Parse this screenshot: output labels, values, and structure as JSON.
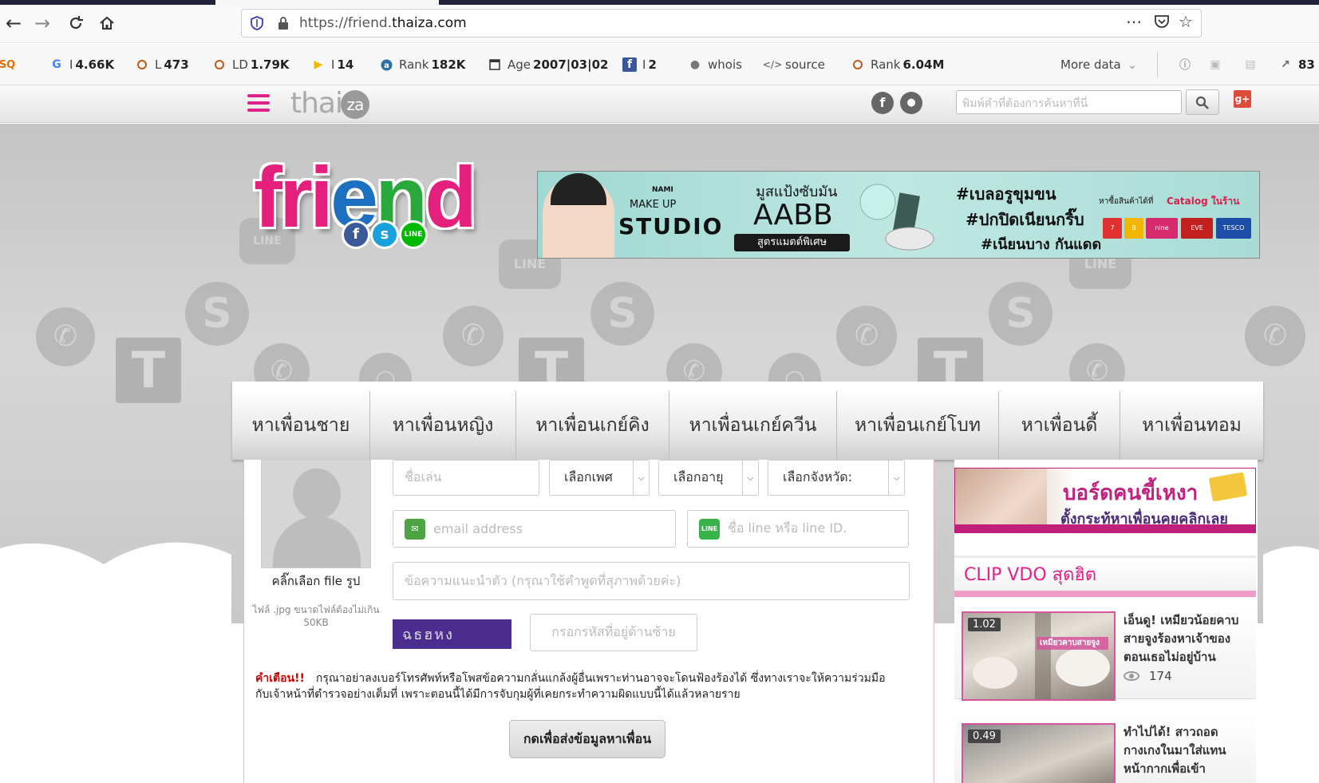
{
  "browser": {
    "url_prefix": "https://friend.",
    "url_domain": "thaiza.com"
  },
  "data_bar": {
    "items": [
      {
        "icon": "seo-icon",
        "label": "",
        "value": ""
      },
      {
        "icon": "google-icon",
        "label": "I",
        "value": "4.66K"
      },
      {
        "icon": "circle-icon",
        "label": "L",
        "value": "473"
      },
      {
        "icon": "circle-icon",
        "label": "LD",
        "value": "1.79K"
      },
      {
        "icon": "bing-icon",
        "label": "I",
        "value": "14"
      },
      {
        "icon": "alexa-icon",
        "label": "Rank",
        "value": "182K"
      },
      {
        "icon": "calendar-icon",
        "label": "Age",
        "value": "2007|03|02"
      },
      {
        "icon": "facebook-icon",
        "label": "I",
        "value": "2"
      },
      {
        "icon": "user-icon",
        "label": "whois",
        "value": ""
      },
      {
        "icon": "code-icon",
        "label": "source",
        "value": ""
      },
      {
        "icon": "circle-icon",
        "label": "Rank",
        "value": "6.04M"
      }
    ],
    "more_data": "More data",
    "external_count": "83"
  },
  "site_header": {
    "search_placeholder": "พิมพ์คำที่ต้องการค้นหาที่นี่",
    "gplus": "g+"
  },
  "banner": {
    "brand_small": "NAMI",
    "brand_mid": "MAKE UP",
    "brand_studio": "STUDIO",
    "headline": "มูสแป้งซับมัน",
    "product": "AABB",
    "pill": "สูตรแมตต์พิเศษ",
    "tag1": "#เบลอรูขุมขน",
    "tag2": "#ปกปิดเนียนกริ๊บ",
    "tag3": "#เนียนบาง กันแดด",
    "shop_note": "หาซื้อสินค้าได้ที่",
    "catalog": "Catalog ในร้าน"
  },
  "menu": {
    "items": [
      "หาเพื่อนชาย",
      "หาเพื่อนหญิง",
      "หาเพื่อนเกย์คิง",
      "หาเพื่อนเกย์ควีน",
      "หาเพื่อนเกย์โบท",
      "หาเพื่อนดี้",
      "หาเพื่อนทอม"
    ]
  },
  "form": {
    "pick_file": "คลิ๊กเลือก file รูป",
    "file_hint": "ไฟล์ .jpg ขนาดไฟล์ต้องไม่เกิน 50KB",
    "nickname_placeholder": "ชื่อเล่น",
    "gender_select": "เลือกเพศ",
    "age_select": "เลือกอายุ",
    "province_select": "เลือกจังหวัด:",
    "email_placeholder": "email address",
    "line_placeholder": "ชื่อ line หรือ line ID.",
    "intro_placeholder": "ข้อความแนะนำตัว (กรุณาใช้คำพูดที่สุภาพด้วยค่ะ)",
    "captcha_text": "ฉธฮหง",
    "captcha_placeholder": "กรอกรหัสที่อยู่ด้านซ้าย",
    "warning_label": "คำเตือน!!",
    "warning_text": "กรุณาอย่าลงเบอร์โทรศัพท์หรือโพสข้อความกลั่นแกล้งผู้อื่นเพราะท่านอาจจะโดนฟ้องร้องได้ ซึ่งทางเราจะให้ความร่วมมือกับเจ้าหน้าที่ตำรวจอย่างเต็มที่ เพราะตอนนี้ได้มีการจับกุมผู้ที่เคยกระทำความผิดแบบนี้ได้แล้วหลายราย",
    "submit": "กดเพื่อส่งข้อมูลหาเพื่อน"
  },
  "sidebar": {
    "promo_line1": "บอร์ดคนขี้เหงา",
    "promo_line2": "ตั้งกระทู้หาเพื่อนคุยคลิกเลย",
    "clip_heading": "CLIP VDO สุดฮิต",
    "clips": [
      {
        "duration": "1.02",
        "title": "เอ็นดู! เหมียวน้อยคาบสายจูงร้องหาเจ้าของ ตอนเธอไม่อยู่บ้าน",
        "views": "174",
        "thumb_caption": "เหมียวคาบสายจูง"
      },
      {
        "duration": "0.49",
        "title": "ทำไปได้! สาวถอดกางเกงในมาใส่แทนหน้ากากเพื่อเข้า",
        "views": "",
        "thumb_caption": ""
      }
    ]
  }
}
